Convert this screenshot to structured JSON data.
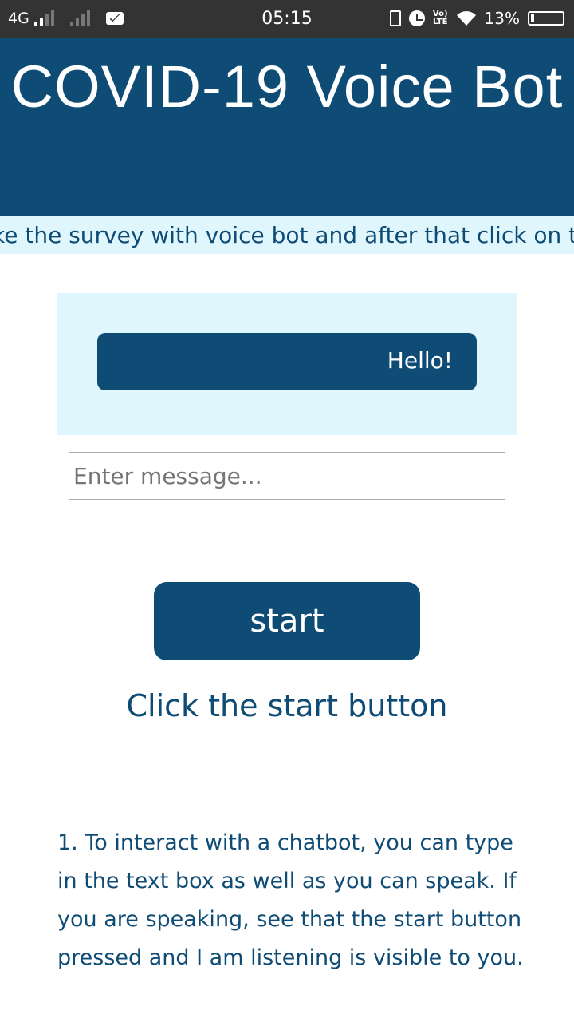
{
  "status_bar": {
    "network": "4G",
    "time": "05:15",
    "battery": "13%",
    "volte": "Vo) LTE"
  },
  "header": {
    "title": "COVID-19 Voice Bot"
  },
  "marquee": {
    "text": "ke the survey with voice bot and after that click on th"
  },
  "chat": {
    "bot_message": "Hello!"
  },
  "message_input": {
    "placeholder": "Enter message...",
    "value": ""
  },
  "start_button": {
    "label": "start"
  },
  "status_hint": "Click the start button",
  "instructions": "1. To interact with a chatbot, you can type in the text box as well as you can speak. If you are speaking, see that the start button pressed and I am listening is visible to you.",
  "colors": {
    "primary": "#0f4c75",
    "light_bg": "#e0f6fd",
    "status_bar": "#333333"
  }
}
